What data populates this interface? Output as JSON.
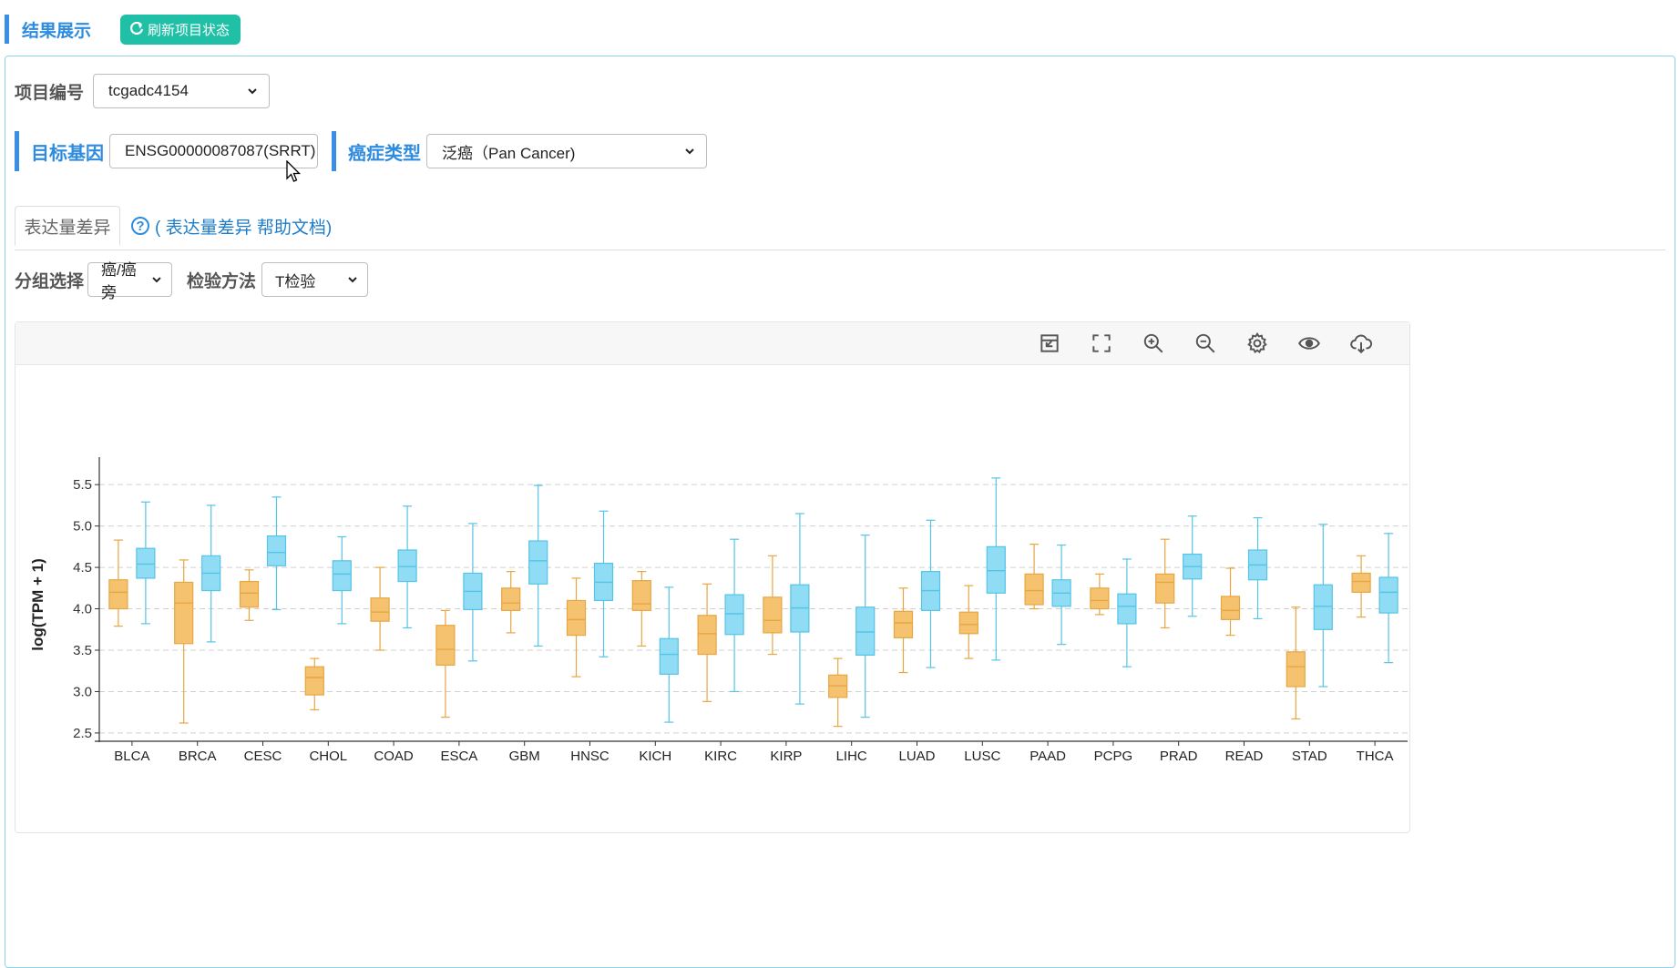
{
  "header": {
    "title": "结果展示",
    "refresh_label": "刷新项目状态"
  },
  "project": {
    "label": "项目编号",
    "value": "tcgadc4154"
  },
  "gene": {
    "label": "目标基因",
    "value": "ENSG00000087087(SRRT)"
  },
  "cancer": {
    "label": "癌症类型",
    "value": "泛癌（Pan Cancer)"
  },
  "tabs": {
    "active": "表达量差异",
    "help": "( 表达量差异 帮助文档)"
  },
  "group": {
    "label": "分组选择",
    "value": "癌/癌旁"
  },
  "test": {
    "label": "检验方法",
    "value": "T检验"
  },
  "toolbar_icons": [
    "restore-icon",
    "fullscreen-icon",
    "zoom-in-icon",
    "zoom-out-icon",
    "gear-icon",
    "eye-icon",
    "cloud-download-icon"
  ],
  "colors": {
    "tumor": "#f5c36f",
    "tumor_stroke": "#e8a640",
    "normal": "#8fdcf4",
    "normal_stroke": "#55c4e6",
    "accent": "#2f8bde",
    "refresh": "#1fc0a6"
  },
  "chart_data": {
    "type": "box",
    "ylabel": "log(TPM + 1)",
    "xlabel": "",
    "ylim": [
      2.4,
      5.7
    ],
    "yticks": [
      2.5,
      3.0,
      3.5,
      4.0,
      4.5,
      5.0,
      5.5
    ],
    "grid": true,
    "categories": [
      "BLCA",
      "BRCA",
      "CESC",
      "CHOL",
      "COAD",
      "ESCA",
      "GBM",
      "HNSC",
      "KICH",
      "KIRC",
      "KIRP",
      "LIHC",
      "LUAD",
      "LUSC",
      "PAAD",
      "PCPG",
      "PRAD",
      "READ",
      "STAD",
      "THCA"
    ],
    "series": [
      {
        "boxes": [
          [
            3.79,
            4.0,
            4.2,
            4.35,
            4.83
          ],
          [
            2.62,
            3.58,
            4.07,
            4.32,
            4.59
          ],
          [
            3.86,
            4.02,
            4.19,
            4.33,
            4.47
          ],
          [
            2.78,
            2.96,
            3.17,
            3.3,
            3.4
          ],
          [
            3.5,
            3.85,
            3.96,
            4.13,
            4.5
          ],
          [
            2.69,
            3.32,
            3.51,
            3.8,
            3.98
          ],
          [
            3.71,
            3.98,
            4.07,
            4.25,
            4.45
          ],
          [
            3.18,
            3.68,
            3.87,
            4.1,
            4.37
          ],
          [
            3.55,
            3.98,
            4.06,
            4.34,
            4.45
          ],
          [
            2.88,
            3.45,
            3.7,
            3.92,
            4.3
          ],
          [
            3.45,
            3.71,
            3.86,
            4.14,
            4.64
          ],
          [
            2.58,
            2.93,
            3.07,
            3.2,
            3.4
          ],
          [
            3.23,
            3.65,
            3.83,
            3.97,
            4.25
          ],
          [
            3.4,
            3.7,
            3.81,
            3.96,
            4.28
          ],
          [
            4.0,
            4.05,
            4.22,
            4.42,
            4.78
          ],
          [
            3.93,
            4.0,
            4.1,
            4.25,
            4.42
          ],
          [
            3.77,
            4.07,
            4.32,
            4.42,
            4.84
          ],
          [
            3.68,
            3.87,
            3.98,
            4.15,
            4.49
          ],
          [
            2.67,
            3.06,
            3.3,
            3.48,
            4.02
          ],
          [
            3.9,
            4.2,
            4.33,
            4.43,
            4.64
          ]
        ]
      },
      {
        "boxes": [
          [
            3.82,
            4.37,
            4.54,
            4.73,
            5.29
          ],
          [
            3.6,
            4.22,
            4.43,
            4.64,
            5.25
          ],
          [
            3.99,
            4.52,
            4.68,
            4.88,
            5.35
          ],
          [
            3.82,
            4.22,
            4.42,
            4.58,
            4.87
          ],
          [
            3.77,
            4.33,
            4.51,
            4.71,
            5.24
          ],
          [
            3.37,
            3.99,
            4.21,
            4.43,
            5.03
          ],
          [
            3.55,
            4.3,
            4.58,
            4.82,
            5.49
          ],
          [
            3.42,
            4.1,
            4.32,
            4.55,
            5.18
          ],
          [
            2.63,
            3.21,
            3.45,
            3.64,
            4.26
          ],
          [
            3.0,
            3.69,
            3.94,
            4.17,
            4.84
          ],
          [
            2.85,
            3.72,
            4.01,
            4.29,
            5.15
          ],
          [
            2.69,
            3.44,
            3.72,
            4.02,
            4.89
          ],
          [
            3.29,
            3.98,
            4.22,
            4.45,
            5.07
          ],
          [
            3.38,
            4.19,
            4.46,
            4.75,
            5.58
          ],
          [
            3.57,
            4.03,
            4.19,
            4.35,
            4.77
          ],
          [
            3.3,
            3.82,
            4.03,
            4.18,
            4.6
          ],
          [
            3.91,
            4.36,
            4.51,
            4.66,
            5.12
          ],
          [
            3.88,
            4.35,
            4.53,
            4.71,
            5.1
          ],
          [
            3.06,
            3.75,
            4.03,
            4.29,
            5.02
          ],
          [
            3.35,
            3.95,
            4.2,
            4.38,
            4.91
          ]
        ]
      }
    ]
  }
}
